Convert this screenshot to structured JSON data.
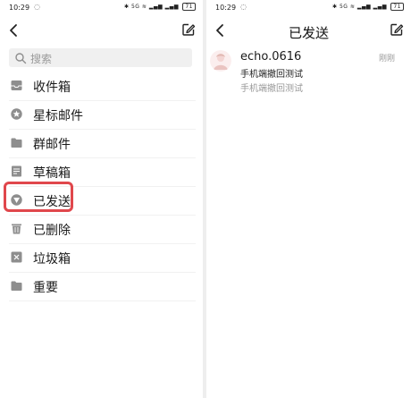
{
  "status_bar": {
    "time": "10:29",
    "network": "5G",
    "battery": "71"
  },
  "left_panel": {
    "search": {
      "placeholder": "搜索"
    },
    "folders": [
      {
        "label": "收件箱",
        "icon": "inbox-icon"
      },
      {
        "label": "星标邮件",
        "icon": "star-icon"
      },
      {
        "label": "群邮件",
        "icon": "folder-icon"
      },
      {
        "label": "草稿箱",
        "icon": "draft-icon"
      },
      {
        "label": "已发送",
        "icon": "sent-icon",
        "highlighted": true
      },
      {
        "label": "已删除",
        "icon": "trash-icon"
      },
      {
        "label": "垃圾箱",
        "icon": "spam-icon"
      },
      {
        "label": "重要",
        "icon": "folder-icon"
      }
    ],
    "highlight_color": "#e0474c"
  },
  "right_panel": {
    "title": "已发送",
    "emails": [
      {
        "sender": "echo.0616",
        "time": "刚刚",
        "subject": "手机端撤回测试",
        "preview": "手机端撤回测试"
      }
    ]
  },
  "colors": {
    "icon_gray": "#8e8e8e",
    "accent_red": "#e0474c"
  }
}
